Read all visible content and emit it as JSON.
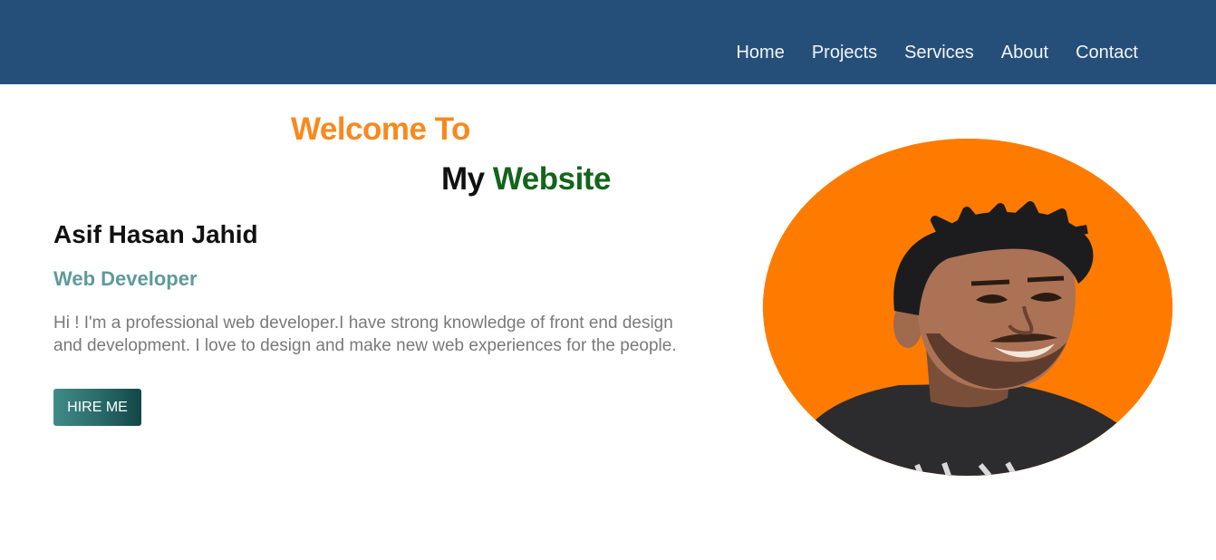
{
  "nav": {
    "items": [
      {
        "label": "Home"
      },
      {
        "label": "Projects"
      },
      {
        "label": "Services"
      },
      {
        "label": "About"
      },
      {
        "label": "Contact"
      }
    ]
  },
  "hero": {
    "welcome": "Welcome To",
    "my": "My",
    "website": "Website",
    "name": "Asif Hasan Jahid",
    "role": "Web Developer",
    "bio": "Hi ! I'm a professional web developer.I have strong knowledge of front end design and development. I love to design and make new web experiences for the people.",
    "hire_label": "HIRE ME"
  },
  "colors": {
    "navbar": "#254f79",
    "welcome": "#f7891e",
    "website": "#14641a",
    "role": "#5f9a9a",
    "avatar_bg": "#ff7b00"
  }
}
